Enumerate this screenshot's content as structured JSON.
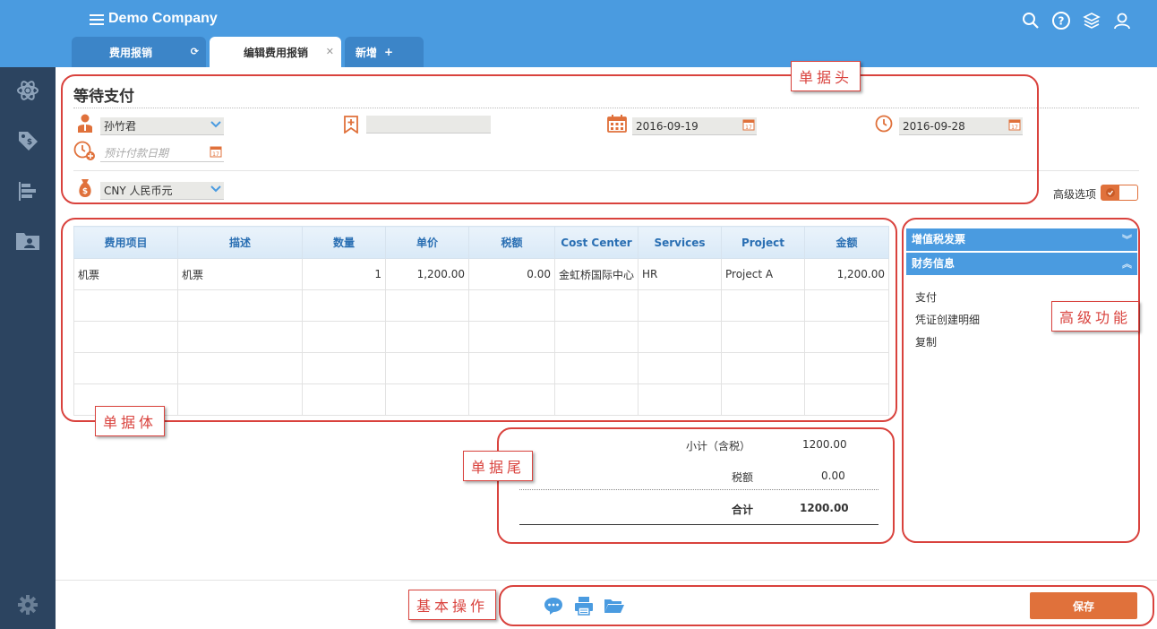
{
  "app": {
    "company": "Demo Company"
  },
  "tabs": [
    {
      "label": "费用报销",
      "icon": "refresh-icon"
    },
    {
      "label": "编辑费用报销",
      "icon": "close-icon"
    },
    {
      "label": "新增",
      "icon": "plus-icon"
    }
  ],
  "header": {
    "title": "等待支付",
    "employee": "孙竹君",
    "reference": "",
    "date": "2016-09-19",
    "due_date": "2016-09-28",
    "expected_payment_placeholder": "预计付款日期",
    "currency": "CNY 人民币元",
    "advanced_label": "高级选项"
  },
  "table": {
    "columns": [
      "费用项目",
      "描述",
      "数量",
      "单价",
      "税额",
      "Cost Center",
      "Services",
      "Project",
      "金额"
    ],
    "rows": [
      [
        "机票",
        "机票",
        "1",
        "1,200.00",
        "0.00",
        "金虹桥国际中心",
        "HR",
        "Project A",
        "1,200.00"
      ]
    ]
  },
  "right_panel": {
    "vat_label": "增值税发票",
    "finance_label": "财务信息",
    "items": [
      "支付",
      "凭证创建明细",
      "复制"
    ]
  },
  "totals": {
    "subtotal_label": "小计（含税）",
    "subtotal": "1200.00",
    "tax_label": "税额",
    "tax": "0.00",
    "total_label": "合计",
    "total": "1200.00"
  },
  "actions": {
    "save": "保存"
  },
  "annotations": {
    "header": "单据头",
    "body": "单据体",
    "footer": "单据尾",
    "advanced": "高级功能",
    "basic": "基本操作"
  },
  "colors": {
    "topbar": "#4a9be0",
    "sidebar": "#2c4460",
    "accent": "#e0713b",
    "annotation": "#d9423d"
  }
}
